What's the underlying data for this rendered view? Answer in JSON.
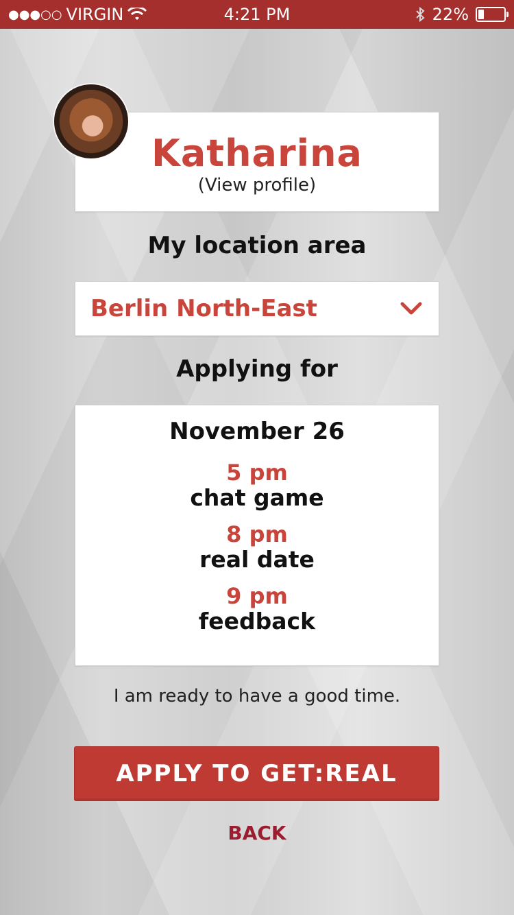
{
  "status_bar": {
    "signal": "●●●○○",
    "carrier": "VIRGIN",
    "time": "4:21 PM",
    "battery_percent": "22%",
    "battery_level": 0.22
  },
  "profile": {
    "name": "Katharina",
    "view_profile": "(View profile)"
  },
  "location": {
    "label": "My location area",
    "selected": "Berlin North-East"
  },
  "application": {
    "label": "Applying for",
    "date": "November 26",
    "slots": [
      {
        "time": "5 pm",
        "event": "chat game"
      },
      {
        "time": "8 pm",
        "event": "real date"
      },
      {
        "time": "9 pm",
        "event": "feedback"
      }
    ]
  },
  "tagline": "I am ready to have a good time.",
  "actions": {
    "apply": "APPLY TO GET:REAL",
    "back": "BACK"
  },
  "colors": {
    "accent": "#c9443a",
    "status_bar": "#a52f2c",
    "button": "#bf3a33",
    "back_link": "#9c1d2f"
  }
}
